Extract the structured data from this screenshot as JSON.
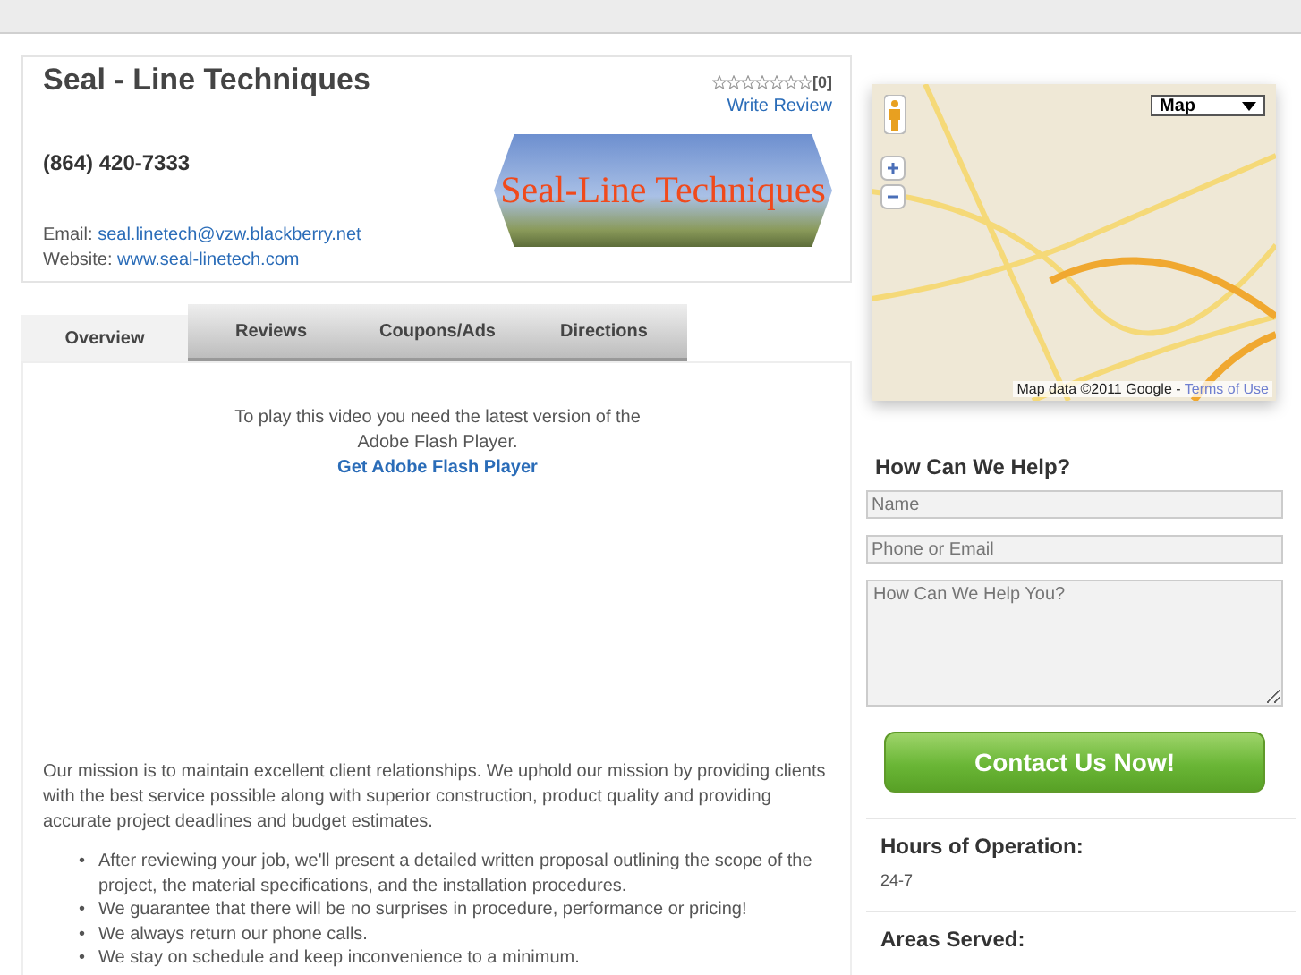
{
  "business": {
    "name": "Seal - Line Techniques",
    "rating": {
      "stars": 0,
      "count": "[0]"
    },
    "write_review": "Write Review",
    "phone": "(864) 420-7333",
    "email_label": "Email:",
    "email": "seal.linetech@vzw.blackberry.net",
    "website_label": "Website:",
    "website": "www.seal-linetech.com",
    "logo_text": "Seal-Line Techniques"
  },
  "tabs": [
    {
      "label": "Overview",
      "selected": true
    },
    {
      "label": "Reviews",
      "selected": false
    },
    {
      "label": "Coupons/Ads",
      "selected": false
    },
    {
      "label": "Directions",
      "selected": false
    }
  ],
  "video": {
    "message": "To play this video you need the latest version of the Adobe Flash Player.",
    "link": "Get Adobe Flash Player"
  },
  "mission": "Our mission is to maintain excellent client relationships. We uphold our mission by providing clients with the best service possible along with superior construction, product quality and providing accurate project deadlines and budget estimates.",
  "bullets": [
    {
      "marker": "•",
      "text": "After reviewing your job, we'll present a detailed written proposal outlining the scope of the project, the material specifications, and the installation procedures."
    },
    {
      "marker": "•",
      "text": "We guarantee that there will be no surprises in procedure, performance or pricing!"
    },
    {
      "marker": "•",
      "text": "We always return our phone calls."
    },
    {
      "marker": "•",
      "text": "We stay on schedule and keep inconvenience to a minimum."
    }
  ],
  "map": {
    "map_type": "Map",
    "attribution": "Map data ©2011 Google -",
    "terms": "Terms of Use"
  },
  "contact_form": {
    "title": "How Can We Help?",
    "fields": [
      {
        "placeholder": "Name"
      },
      {
        "placeholder": "Phone or Email"
      }
    ],
    "message_placeholder": "How Can We Help You?",
    "submit": "Contact Us Now!"
  },
  "hours": {
    "title": "Hours of Operation:",
    "value": "24-7"
  },
  "areas": {
    "title": "Areas Served:"
  }
}
